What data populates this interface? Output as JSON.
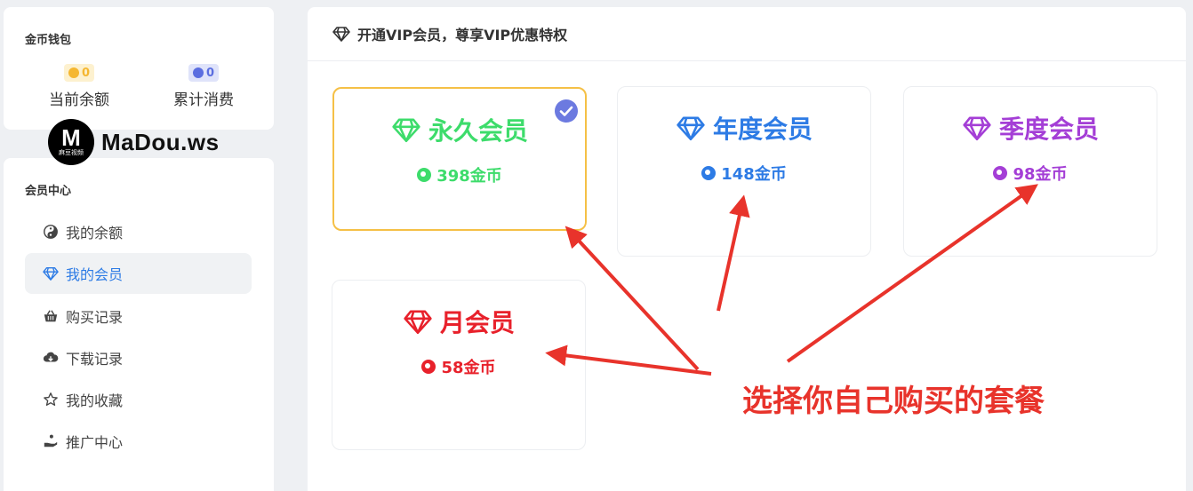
{
  "wallet": {
    "title": "金币钱包",
    "balance": {
      "value": "0",
      "label": "当前余额",
      "color": "#f5b731",
      "bg": "#fdf1cf"
    },
    "spent": {
      "value": "0",
      "label": "累计消费",
      "color": "#5b6ee0",
      "bg": "#dfe3fa"
    }
  },
  "watermark": {
    "logo_letter": "M",
    "logo_sub": "麻豆视频",
    "text": "MaDou.ws"
  },
  "member_center": {
    "title": "会员中心",
    "items": [
      {
        "label": "我的余额",
        "icon": "yin-yang-icon"
      },
      {
        "label": "我的会员",
        "icon": "diamond-icon",
        "active": true
      },
      {
        "label": "购买记录",
        "icon": "basket-icon"
      },
      {
        "label": "下载记录",
        "icon": "cloud-download-icon"
      },
      {
        "label": "我的收藏",
        "icon": "star-icon"
      },
      {
        "label": "推广中心",
        "icon": "hand-coin-icon"
      }
    ]
  },
  "main": {
    "header": "开通VIP会员，尊享VIP优惠特权",
    "plans": [
      {
        "name": "永久会员",
        "price": "398金币",
        "color": "#3ddc6b",
        "selected": true
      },
      {
        "name": "年度会员",
        "price": "148金币",
        "color": "#2d7be5",
        "selected": false
      },
      {
        "name": "季度会员",
        "price": "98金币",
        "color": "#a43ed6",
        "selected": false
      },
      {
        "name": "月会员",
        "price": "58金币",
        "color": "#e8212b",
        "selected": false
      }
    ]
  },
  "annotation": {
    "text": "选择你自己购买的套餐",
    "color": "#e8332b"
  }
}
